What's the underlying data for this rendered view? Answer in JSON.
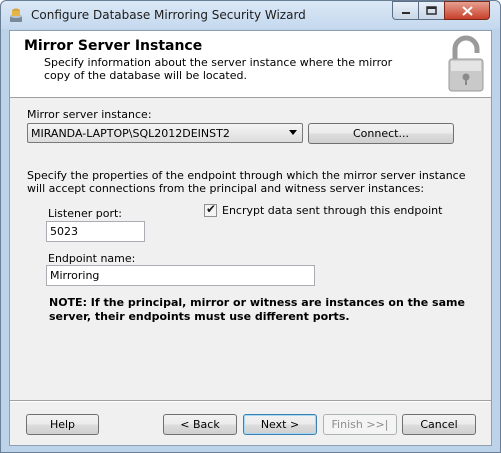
{
  "window": {
    "title": "Configure Database Mirroring Security Wizard"
  },
  "header": {
    "title": "Mirror Server Instance",
    "description": "Specify information about the server instance where the mirror copy of the database will be located."
  },
  "mirror_instance": {
    "label": "Mirror server instance:",
    "selected": "MIRANDA-LAPTOP\\SQL2012DEINST2",
    "connect_label": "Connect..."
  },
  "endpoint": {
    "description": "Specify the properties of the endpoint through which the mirror server instance will accept connections from the principal and witness server instances:",
    "listener_port_label": "Listener port:",
    "listener_port_value": "5023",
    "encrypt_label": "Encrypt data sent through this endpoint",
    "encrypt_checked": true,
    "endpoint_name_label": "Endpoint name:",
    "endpoint_name_value": "Mirroring"
  },
  "note": "NOTE: If the principal, mirror or witness are instances on the same server, their endpoints must use different ports.",
  "footer": {
    "help": "Help",
    "back": "< Back",
    "next": "Next >",
    "finish": "Finish >>|",
    "cancel": "Cancel"
  }
}
